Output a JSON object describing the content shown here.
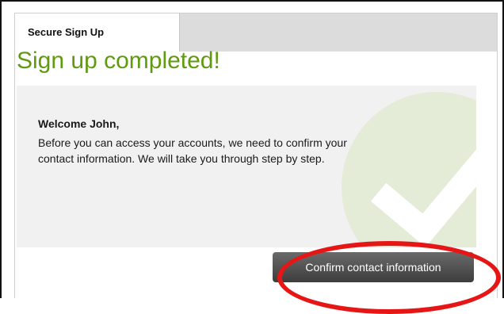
{
  "tab": {
    "label": "Secure Sign Up"
  },
  "page": {
    "title": "Sign up completed!"
  },
  "message": {
    "greeting": "Welcome John,",
    "line1": "Before you can access your accounts, we need to confirm your",
    "line2": "contact information. We will take you through step by step."
  },
  "actions": {
    "confirm_label": "Confirm contact information"
  },
  "colors": {
    "title": "#5f9a10",
    "highlight": "#e61616",
    "button": "#4a4a4a"
  },
  "icons": {
    "success": "checkmark-icon"
  }
}
